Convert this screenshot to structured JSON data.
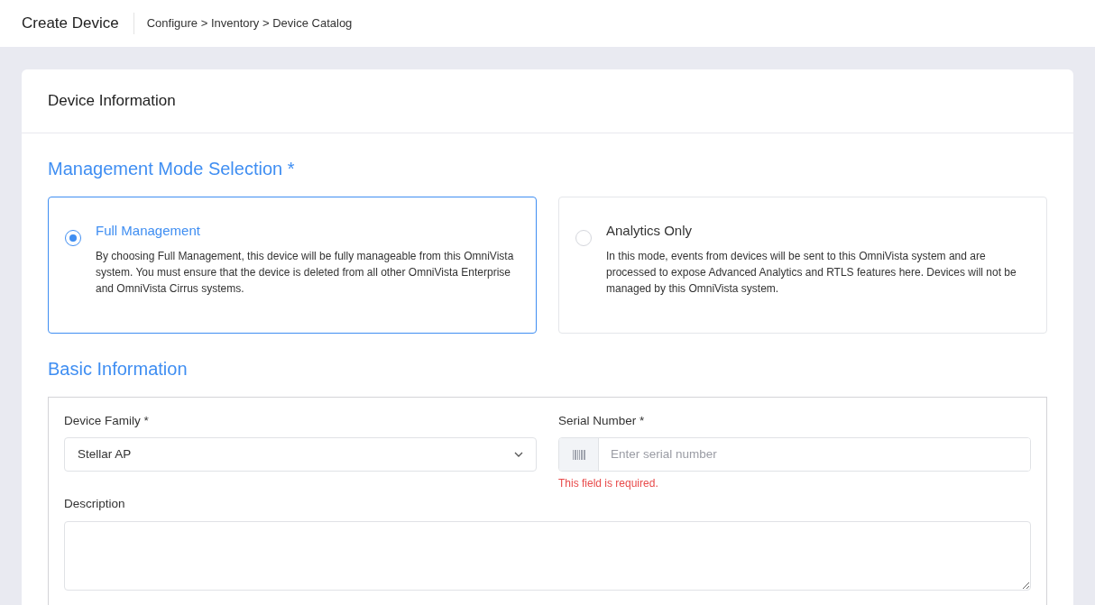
{
  "header": {
    "title": "Create Device",
    "breadcrumb": "Configure > Inventory > Device Catalog"
  },
  "card": {
    "title": "Device Information",
    "mode_section": {
      "heading": "Management Mode Selection *",
      "options": [
        {
          "title": "Full Management",
          "description": "By choosing Full Management, this device will be fully manageable from this OmniVista system. You must ensure that the device is deleted from all other OmniVista Enterprise and OmniVista Cirrus systems.",
          "selected": true
        },
        {
          "title": "Analytics Only",
          "description": "In this mode, events from devices will be sent to this OmniVista system and are processed to expose Advanced Analytics and RTLS features here. Devices will not be managed by this OmniVista system.",
          "selected": false
        }
      ]
    },
    "basic_section": {
      "heading": "Basic Information",
      "device_family": {
        "label": "Device Family *",
        "value": "Stellar AP"
      },
      "serial_number": {
        "label": "Serial Number *",
        "placeholder": "Enter serial number",
        "error": "This field is required."
      },
      "description": {
        "label": "Description"
      }
    }
  }
}
